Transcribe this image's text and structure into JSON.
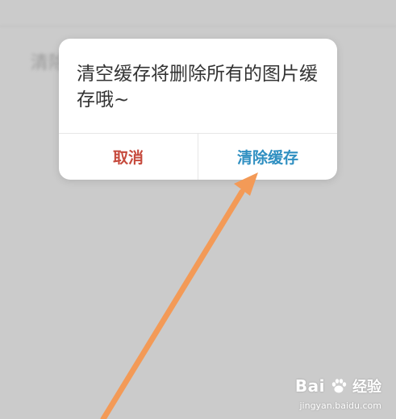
{
  "background": {
    "top_text": "",
    "clear_text": "清除"
  },
  "dialog": {
    "message": "清空缓存将删除所有的图片缓存哦~",
    "cancel_label": "取消",
    "confirm_label": "清除缓存"
  },
  "colors": {
    "cancel": "#c64a3d",
    "confirm": "#2f8fc1",
    "arrow": "#f39a57",
    "overlay": "#cbcbcb"
  },
  "watermark": {
    "brand": "Bai",
    "brand_suffix": "经验",
    "url": "jingyan.baidu.com"
  }
}
